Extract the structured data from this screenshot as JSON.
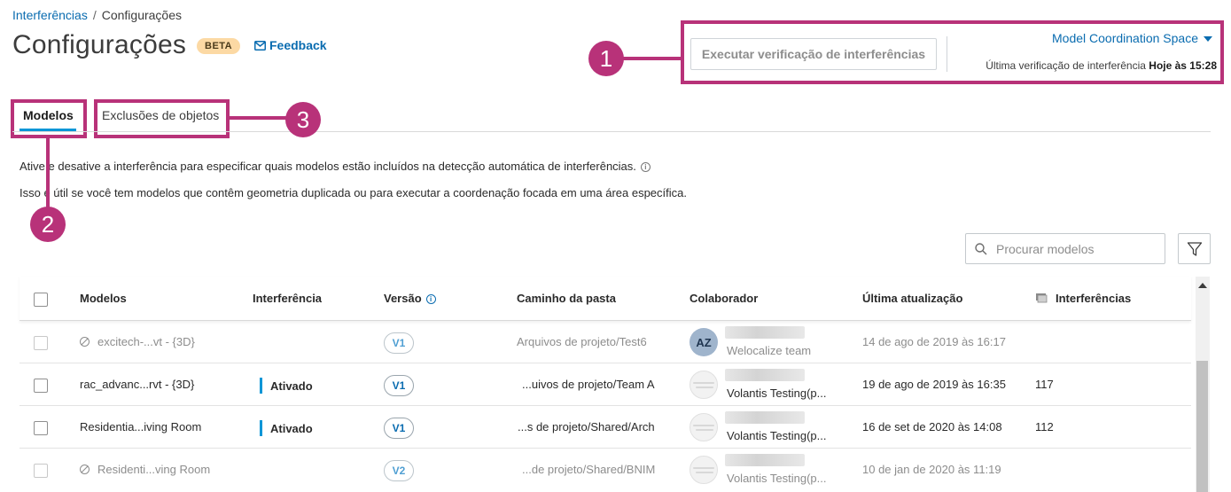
{
  "breadcrumb": {
    "parent": "Interferências",
    "separator": "/",
    "current": "Configurações"
  },
  "page": {
    "title": "Configurações",
    "badge": "BETA",
    "feedback": "Feedback"
  },
  "header": {
    "run_button": "Executar verificação de interferências",
    "space": "Model Coordination Space",
    "last_check_label": "Última verificação de interferência",
    "last_check_value": "Hoje às 15:28"
  },
  "tabs": [
    {
      "label": "Modelos",
      "active": true
    },
    {
      "label": "Exclusões de objetos",
      "active": false
    }
  ],
  "callouts": [
    "1",
    "2",
    "3"
  ],
  "description": {
    "line1": "Ative e desative a interferência para especificar quais modelos estão incluídos na detecção automática de interferências.",
    "line2": "Isso é útil se você tem modelos que contêm geometria duplicada ou para executar a coordenação focada em uma área específica."
  },
  "search": {
    "placeholder": "Procurar modelos"
  },
  "table": {
    "headers": {
      "models": "Modelos",
      "clash": "Interferência",
      "version": "Versão",
      "path": "Caminho da pasta",
      "collaborator": "Colaborador",
      "updated": "Última atualização",
      "clashes": "Interferências"
    },
    "rows": [
      {
        "name": "excitech-...vt - {3D}",
        "status": "",
        "version": "V1",
        "path": "Arquivos de projeto/Test6",
        "avatar": "AZ",
        "team": "Welocalize team",
        "updated": "14 de ago de 2019 às 16:17",
        "clashes": "",
        "disabled": true
      },
      {
        "name": "rac_advanc...rvt - {3D}",
        "status": "Ativado",
        "version": "V1",
        "path": "...uivos de projeto/Team A",
        "avatar": "",
        "team": "Volantis Testing(p...",
        "updated": "19 de ago de 2019 às 16:35",
        "clashes": "117",
        "disabled": false
      },
      {
        "name": "Residentia...iving Room",
        "status": "Ativado",
        "version": "V1",
        "path": "...s de projeto/Shared/Arch",
        "avatar": "",
        "team": "Volantis Testing(p...",
        "updated": "16 de set de 2020 às 14:08",
        "clashes": "112",
        "disabled": false
      },
      {
        "name": "Residenti...ving Room",
        "status": "",
        "version": "V2",
        "path": "...de projeto/Shared/BNIM",
        "avatar": "",
        "team": "Volantis Testing(p...",
        "updated": "10 de jan de 2020 às 11:19",
        "clashes": "",
        "disabled": true
      }
    ]
  },
  "colors": {
    "accent": "#0696d7",
    "link": "#0a6cb0",
    "callout": "#b83279",
    "badge": "#fcd9a4"
  },
  "icons": [
    "envelope-icon",
    "caret-down-icon",
    "info-icon",
    "search-icon",
    "filter-icon",
    "ban-icon",
    "layers-icon",
    "scroll-up-icon"
  ]
}
